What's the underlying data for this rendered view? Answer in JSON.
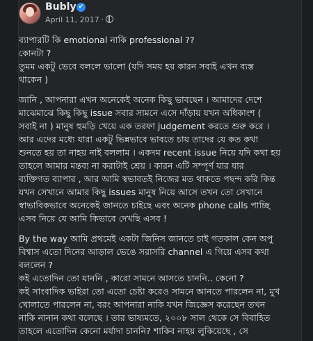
{
  "author": {
    "name": "Bubly",
    "verified_icon": "✔"
  },
  "meta": {
    "date": "April 11, 2017",
    "separator": "·"
  },
  "post": {
    "paragraphs": [
      [
        "ব্যাপারটি কি emotional নাকি professional ??",
        "কোনটা ?",
        "তুমম একটু ভেবে বললে ভালো (যদি সময় হয় কারন সবাই এখন ব্যস্ত",
        "থাকেন )"
      ],
      [
        "জানি , আপনারা এখন অনেকেই অনেক কিছু ভাবছেন । আমাদের দেশে",
        "মাঝেমাঝে কিছু কিছু issue সবার সামনে এসে দাঁড়ায় যখন অধিকাংশ (",
        "সবাই না ) মানুষ হুমড়ি খেয়ে এক তরফা judgement করতে শুরু করে ।",
        "আর এদের মধ্যে যারা একটু ভিন্নভাবে ভাবতে চায় তাদের যে কত কথা",
        "শুনতে হয় তা নাহয় নাই বললাম । একদম recent issue নিয়ে যদি কথা হয়",
        "তাহলে আমার মন্তব্য না করাটাই শ্রেয় । কারন এটি সম্পূর্ণ যার যার",
        "ব্যক্তিগত ব্যাপার , আর আমি স্বভাবতই নিজের মত থাকতে পছন্দ করি কিন্ত",
        "যখন সেখানে আমার কিছু issues মানুষ নিয়ে আসে তখন তো সেখানে",
        "স্বাভাবিকভাবে অনেকেই জানতে চাইছে এবং অনেক phone calls পাচ্ছি",
        "এসব নিয়ে যে আমি কিভাবে দেখছি এসব !"
      ],
      [
        "By the way আমি প্রথমেই একটা জিনিস জানতে চাই গতকাল কেন অপু",
        "বিশ্বাস এতো দিনের আড়াল ভেঙে সরাসরি channel এ গিয়ে এসব কথা",
        "বললেন ?",
        "কই এতোদিন তো যাননি , কারো সামনে আসতে চাননি.. কেনো ?",
        "কই সাংবাদিক ভাইরা তো এতো চেষ্টা করেও সামনে আনতে পারলেন না, মুখ",
        "খোলাতে পারলেন না, বরং আপনারা নাকি যখন জিজ্ঞেস করেছেন তখন",
        "নাকি নানান কথা বলেছে । তার ভাষ্যমতে, ২০০৮ সাল থেকে সে বিবাহিত",
        "তাহলে এতোদিন কেনো মর্যাদা চাননি? শাকিব নাহয় লুকিয়েছে , সে"
      ]
    ]
  }
}
